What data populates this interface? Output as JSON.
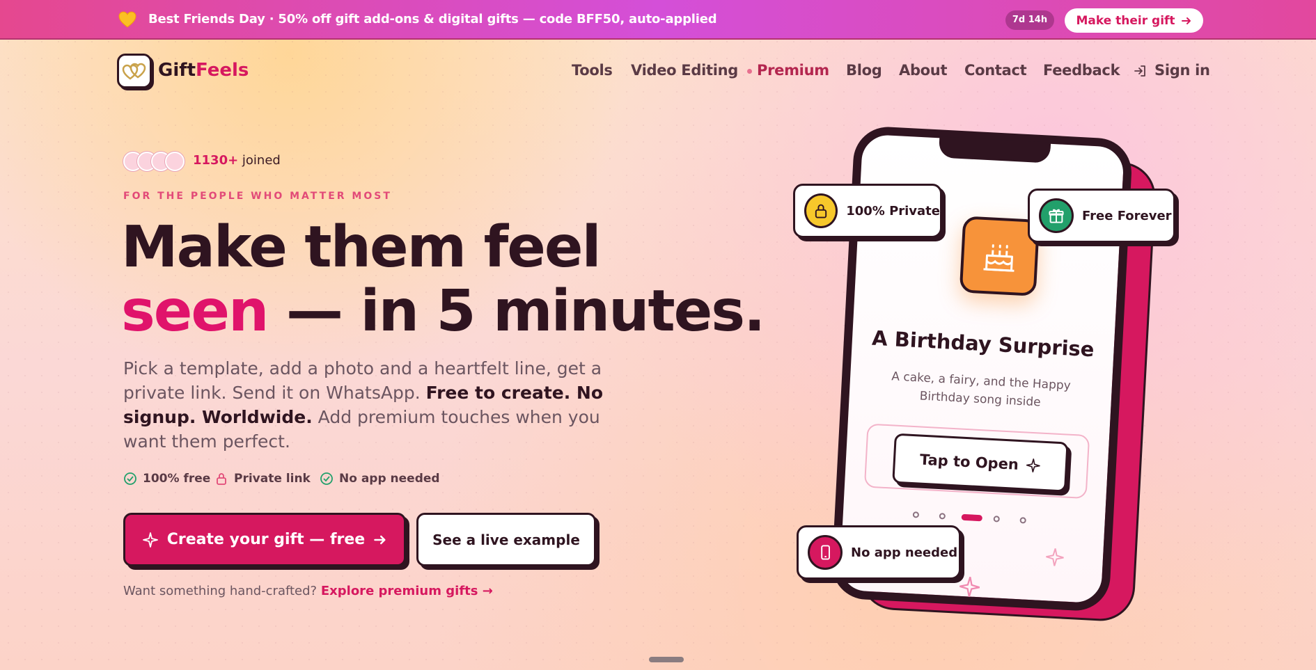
{
  "promo": {
    "icon": "heart-icon",
    "text": "Best Friends Day · 50% off gift add-ons & digital gifts — code BFF50, auto-applied",
    "timer": "7d 14h",
    "cta_label": "Make their gift"
  },
  "brand": {
    "logo_icon": "hearts-logo-icon",
    "name_part1": "Gift",
    "name_part2": "Feels",
    "accent_color": "#d6185f"
  },
  "nav": {
    "items": [
      "Tools",
      "Video Editing",
      "Premium",
      "Blog",
      "About",
      "Contact",
      "Feedback"
    ],
    "signin_label": "Sign in"
  },
  "hero": {
    "joined_count": "1130+",
    "joined_label": "joined",
    "eyebrow": "FOR THE PEOPLE WHO MATTER MOST",
    "headline_line1": "Make them feel",
    "headline_pink": "seen",
    "headline_rest": " — in 5 minutes.",
    "lede_part1": "Pick a template, add a photo and a heartfelt line, get a private link. Send it on WhatsApp. ",
    "lede_bold": "Free to create. No signup. Worldwide.",
    "lede_part2": " Add premium touches when you want them perfect.",
    "ticks": [
      "100% free",
      "Private link",
      "No app needed"
    ],
    "primary_cta": "Create your gift — free",
    "secondary_cta": "See a live example",
    "handcrafted_text": "Want something hand-crafted?",
    "handcrafted_link": "Explore premium gifts →"
  },
  "phone": {
    "card_title": "A Birthday Surprise",
    "card_subtitle": "A cake, a fairy, and the Happy Birthday song inside",
    "tap_label": "Tap to Open",
    "carousel_active_index": 2,
    "carousel_count": 5
  },
  "badges": {
    "private": "100% Private",
    "free": "Free Forever",
    "noapp": "No app needed"
  }
}
